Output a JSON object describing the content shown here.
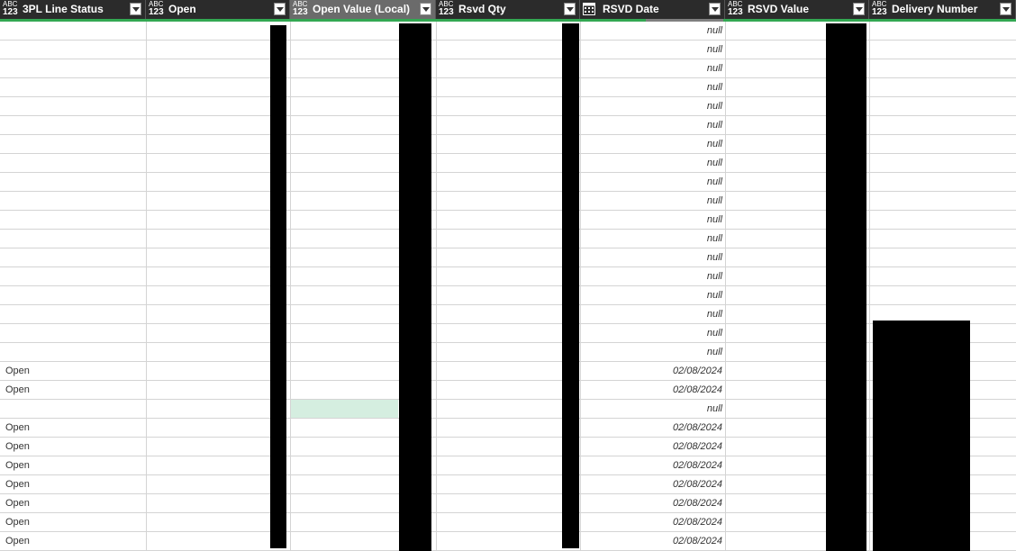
{
  "columns": [
    {
      "title": "3PL Line Status",
      "type_top": "ABC",
      "type_bottom": "123"
    },
    {
      "title": "Open",
      "type_top": "ABC",
      "type_bottom": "123"
    },
    {
      "title": "Open Value (Local)",
      "type_top": "ABC",
      "type_bottom": "123",
      "selected": true
    },
    {
      "title": "Rsvd Qty",
      "type_top": "ABC",
      "type_bottom": "123"
    },
    {
      "title": "RSVD Date",
      "type": "date"
    },
    {
      "title": "RSVD Value",
      "type_top": "ABC",
      "type_bottom": "123"
    },
    {
      "title": "Delivery Number",
      "type_top": "ABC",
      "type_bottom": "123"
    }
  ],
  "rows": [
    {
      "status": "",
      "rsvd_date": "null"
    },
    {
      "status": "",
      "rsvd_date": "null"
    },
    {
      "status": "",
      "rsvd_date": "null"
    },
    {
      "status": "",
      "rsvd_date": "null"
    },
    {
      "status": "",
      "rsvd_date": "null"
    },
    {
      "status": "",
      "rsvd_date": "null"
    },
    {
      "status": "",
      "rsvd_date": "null"
    },
    {
      "status": "",
      "rsvd_date": "null"
    },
    {
      "status": "",
      "rsvd_date": "null"
    },
    {
      "status": "",
      "rsvd_date": "null"
    },
    {
      "status": "",
      "rsvd_date": "null"
    },
    {
      "status": "",
      "rsvd_date": "null"
    },
    {
      "status": "",
      "rsvd_date": "null"
    },
    {
      "status": "",
      "rsvd_date": "null"
    },
    {
      "status": "",
      "rsvd_date": "null"
    },
    {
      "status": "",
      "rsvd_date": "null"
    },
    {
      "status": "",
      "rsvd_date": "null"
    },
    {
      "status": "",
      "rsvd_date": "null"
    },
    {
      "status": "Open",
      "rsvd_date": "02/08/2024"
    },
    {
      "status": "Open",
      "rsvd_date": "02/08/2024"
    },
    {
      "status": "",
      "rsvd_date": "null",
      "open_value_selected": true
    },
    {
      "status": "Open",
      "rsvd_date": "02/08/2024"
    },
    {
      "status": "Open",
      "rsvd_date": "02/08/2024"
    },
    {
      "status": "Open",
      "rsvd_date": "02/08/2024"
    },
    {
      "status": "Open",
      "rsvd_date": "02/08/2024"
    },
    {
      "status": "Open",
      "rsvd_date": "02/08/2024"
    },
    {
      "status": "Open",
      "rsvd_date": "02/08/2024"
    },
    {
      "status": "Open",
      "rsvd_date": "02/08/2024"
    }
  ],
  "colors": {
    "header_bg": "#2b2b2b",
    "header_selected": "#6b6b6b",
    "quality_bar": "#33a852",
    "selected_cell": "#d5eee0",
    "redaction": "#000000"
  }
}
